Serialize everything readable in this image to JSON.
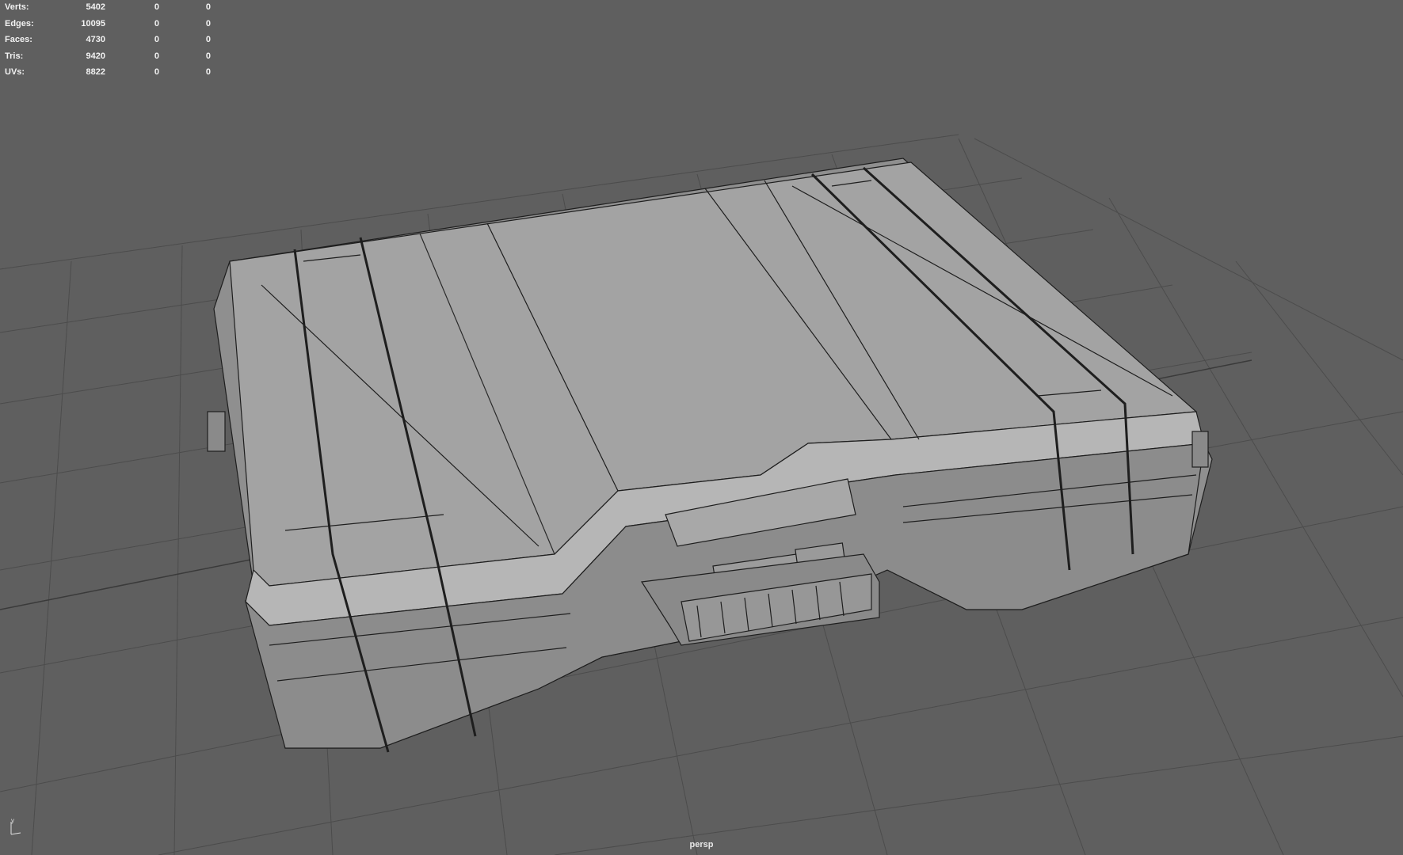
{
  "hud": {
    "rows": [
      {
        "label": "Verts:",
        "v1": "5402",
        "v2": "0",
        "v3": "0"
      },
      {
        "label": "Edges:",
        "v1": "10095",
        "v2": "0",
        "v3": "0"
      },
      {
        "label": "Faces:",
        "v1": "4730",
        "v2": "0",
        "v3": "0"
      },
      {
        "label": "Tris:",
        "v1": "9420",
        "v2": "0",
        "v3": "0"
      },
      {
        "label": "UVs:",
        "v1": "8822",
        "v2": "0",
        "v3": "0"
      }
    ]
  },
  "camera": {
    "label": "persp"
  },
  "axis": {
    "y_label": "y"
  },
  "colors": {
    "background": "#5f5f5f",
    "grid": "#4a4a4a",
    "mesh_fill": "#9a9a9a",
    "wire": "#1e1e1e",
    "hud_text": "#f2f2f2"
  },
  "icons": {
    "axis": "axis-gizmo-icon"
  }
}
